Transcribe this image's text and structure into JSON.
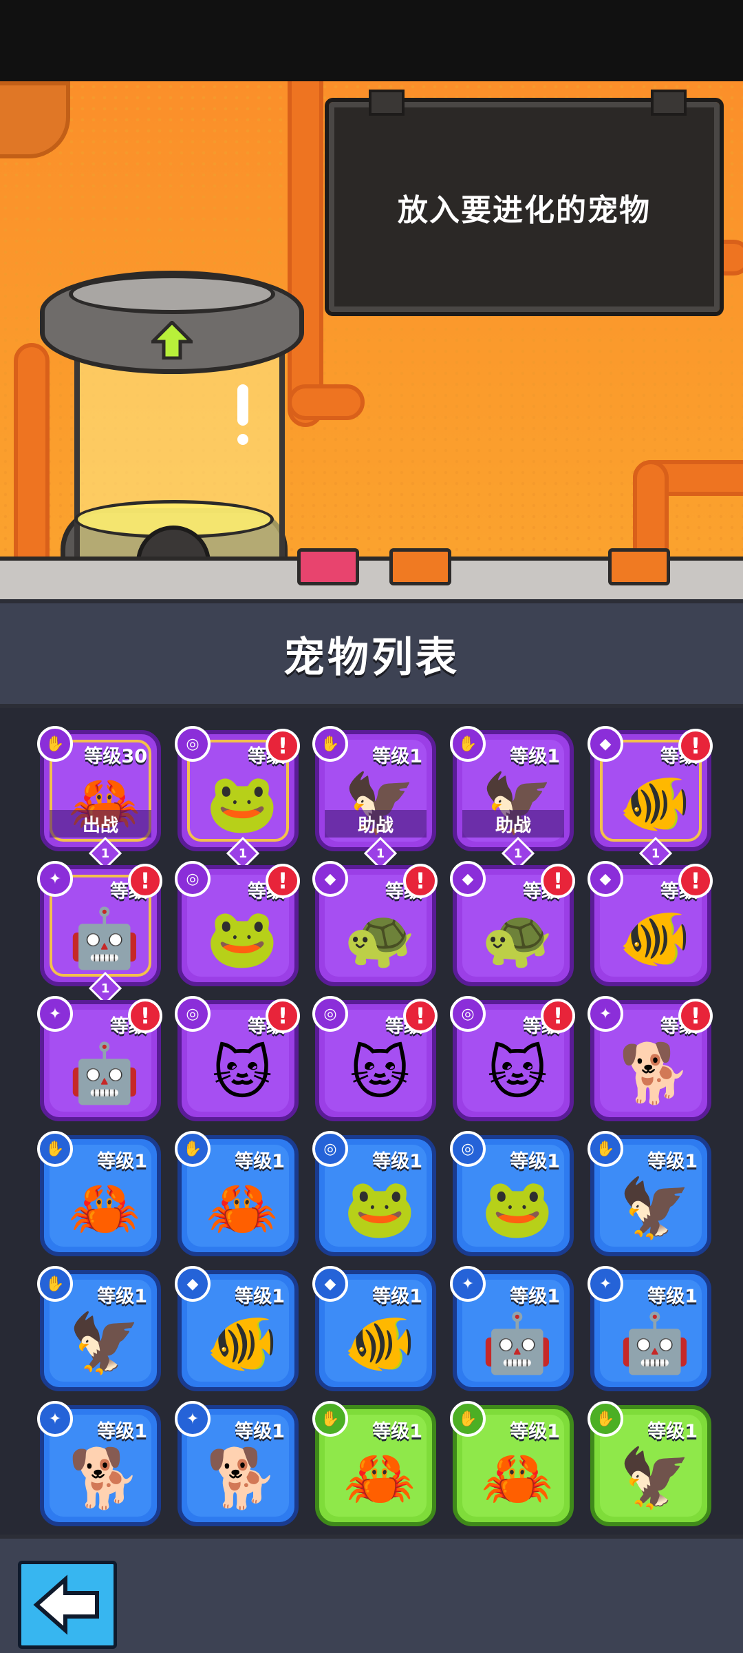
{
  "board": {
    "text": "放入要进化的宠物"
  },
  "list": {
    "title": "宠物列表"
  },
  "colors": {
    "purple": "#9b3fe6",
    "blue": "#2e7bf0",
    "green": "#7fdc3a",
    "alert": "#e8243a"
  },
  "pets": [
    {
      "rarity": "purple",
      "gold": true,
      "badge": "claw-icon",
      "level": "等级30",
      "animal": "crab",
      "role": "出战",
      "star": "1",
      "alert": false
    },
    {
      "rarity": "purple",
      "gold": true,
      "badge": "coin-icon",
      "level": "等级",
      "animal": "frog",
      "role": "",
      "star": "1",
      "alert": true
    },
    {
      "rarity": "purple",
      "gold": false,
      "badge": "claw-icon",
      "level": "等级1",
      "animal": "eagle",
      "role": "助战",
      "star": "1",
      "alert": false
    },
    {
      "rarity": "purple",
      "gold": false,
      "badge": "claw-icon",
      "level": "等级1",
      "animal": "eagle",
      "role": "助战",
      "star": "1",
      "alert": false
    },
    {
      "rarity": "purple",
      "gold": true,
      "badge": "shell-icon",
      "level": "等级",
      "animal": "goldfish",
      "role": "",
      "star": "1",
      "alert": true
    },
    {
      "rarity": "purple",
      "gold": true,
      "badge": "paw-icon",
      "level": "等级",
      "animal": "robot",
      "role": "",
      "star": "1",
      "alert": true
    },
    {
      "rarity": "purple",
      "gold": false,
      "badge": "coin-icon",
      "level": "等级",
      "animal": "frog",
      "role": "",
      "star": "",
      "alert": true
    },
    {
      "rarity": "purple",
      "gold": false,
      "badge": "shell-icon",
      "level": "等级",
      "animal": "turtle",
      "role": "",
      "star": "",
      "alert": true
    },
    {
      "rarity": "purple",
      "gold": false,
      "badge": "shell-icon",
      "level": "等级",
      "animal": "turtle",
      "role": "",
      "star": "",
      "alert": true
    },
    {
      "rarity": "purple",
      "gold": false,
      "badge": "shell-icon",
      "level": "等级",
      "animal": "goldfish",
      "role": "",
      "star": "",
      "alert": true
    },
    {
      "rarity": "purple",
      "gold": false,
      "badge": "paw-icon",
      "level": "等级",
      "animal": "robot",
      "role": "",
      "star": "",
      "alert": true
    },
    {
      "rarity": "purple",
      "gold": false,
      "badge": "coin-icon",
      "level": "等级",
      "animal": "cat",
      "role": "",
      "star": "",
      "alert": true
    },
    {
      "rarity": "purple",
      "gold": false,
      "badge": "coin-icon",
      "level": "等级",
      "animal": "cat",
      "role": "",
      "star": "",
      "alert": true
    },
    {
      "rarity": "purple",
      "gold": false,
      "badge": "coin-icon",
      "level": "等级",
      "animal": "cat",
      "role": "",
      "star": "",
      "alert": true
    },
    {
      "rarity": "purple",
      "gold": false,
      "badge": "paw-icon",
      "level": "等级",
      "animal": "dog",
      "role": "",
      "star": "",
      "alert": true
    },
    {
      "rarity": "blue",
      "gold": false,
      "badge": "claw-icon",
      "level": "等级1",
      "animal": "crab",
      "role": "",
      "star": "",
      "alert": false
    },
    {
      "rarity": "blue",
      "gold": false,
      "badge": "claw-icon",
      "level": "等级1",
      "animal": "crab",
      "role": "",
      "star": "",
      "alert": false
    },
    {
      "rarity": "blue",
      "gold": false,
      "badge": "coin-icon",
      "level": "等级1",
      "animal": "frog",
      "role": "",
      "star": "",
      "alert": false
    },
    {
      "rarity": "blue",
      "gold": false,
      "badge": "coin-icon",
      "level": "等级1",
      "animal": "frog",
      "role": "",
      "star": "",
      "alert": false
    },
    {
      "rarity": "blue",
      "gold": false,
      "badge": "claw-icon",
      "level": "等级1",
      "animal": "eagle",
      "role": "",
      "star": "",
      "alert": false
    },
    {
      "rarity": "blue",
      "gold": false,
      "badge": "claw-icon",
      "level": "等级1",
      "animal": "eagle",
      "role": "",
      "star": "",
      "alert": false
    },
    {
      "rarity": "blue",
      "gold": false,
      "badge": "shell-icon",
      "level": "等级1",
      "animal": "goldfish",
      "role": "",
      "star": "",
      "alert": false
    },
    {
      "rarity": "blue",
      "gold": false,
      "badge": "shell-icon",
      "level": "等级1",
      "animal": "goldfish",
      "role": "",
      "star": "",
      "alert": false
    },
    {
      "rarity": "blue",
      "gold": false,
      "badge": "paw-icon",
      "level": "等级1",
      "animal": "robot",
      "role": "",
      "star": "",
      "alert": false
    },
    {
      "rarity": "blue",
      "gold": false,
      "badge": "paw-icon",
      "level": "等级1",
      "animal": "robot",
      "role": "",
      "star": "",
      "alert": false
    },
    {
      "rarity": "blue",
      "gold": false,
      "badge": "paw-icon",
      "level": "等级1",
      "animal": "dog",
      "role": "",
      "star": "",
      "alert": false
    },
    {
      "rarity": "blue",
      "gold": false,
      "badge": "paw-icon",
      "level": "等级1",
      "animal": "dog",
      "role": "",
      "star": "",
      "alert": false
    },
    {
      "rarity": "green",
      "gold": false,
      "badge": "claw-icon",
      "level": "等级1",
      "animal": "crab",
      "role": "",
      "star": "",
      "alert": false
    },
    {
      "rarity": "green",
      "gold": false,
      "badge": "claw-icon",
      "level": "等级1",
      "animal": "crab",
      "role": "",
      "star": "",
      "alert": false
    },
    {
      "rarity": "green",
      "gold": false,
      "badge": "claw-icon",
      "level": "等级1",
      "animal": "eagle",
      "role": "",
      "star": "",
      "alert": false
    }
  ]
}
